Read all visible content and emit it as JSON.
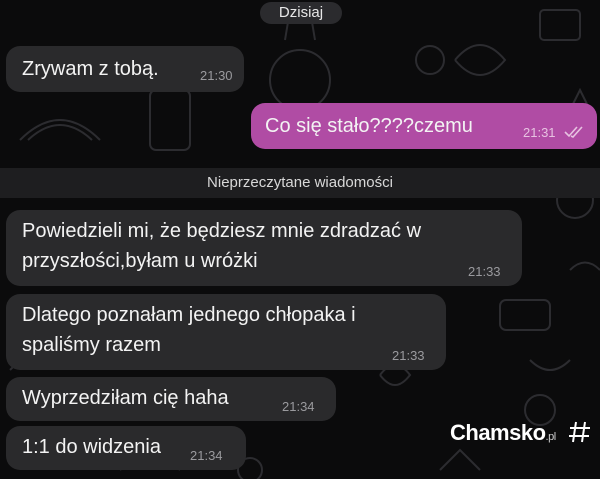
{
  "chat": {
    "date_label": "Dzisiaj",
    "unread_label": "Nieprzeczytane wiadomości",
    "messages": [
      {
        "text": "Zrywam z tobą.",
        "time": "21:30",
        "direction": "incoming"
      },
      {
        "text": "Co się stało????czemu",
        "time": "21:31",
        "direction": "outgoing",
        "read_icon": "double-check-icon"
      },
      {
        "line1": "Powiedzieli mi, że będziesz mnie zdradzać w",
        "line2": "przyszłości,byłam u wróżki",
        "time": "21:33",
        "direction": "incoming"
      },
      {
        "line1": "Dlatego poznałam jednego chłopaka i",
        "line2": "spaliśmy razem",
        "time": "21:33",
        "direction": "incoming"
      },
      {
        "text": "Wyprzedziłam cię haha",
        "time": "21:34",
        "direction": "incoming"
      },
      {
        "text": "1:1 do widzenia",
        "time": "21:34",
        "direction": "incoming"
      }
    ]
  },
  "watermark": {
    "name": "Chamsko",
    "suffix": ".pl",
    "icon": "hash-icon"
  },
  "colors": {
    "background": "#0b0b0c",
    "incoming_bubble": "#2a2a2c",
    "outgoing_bubble": "#b04ca4"
  }
}
